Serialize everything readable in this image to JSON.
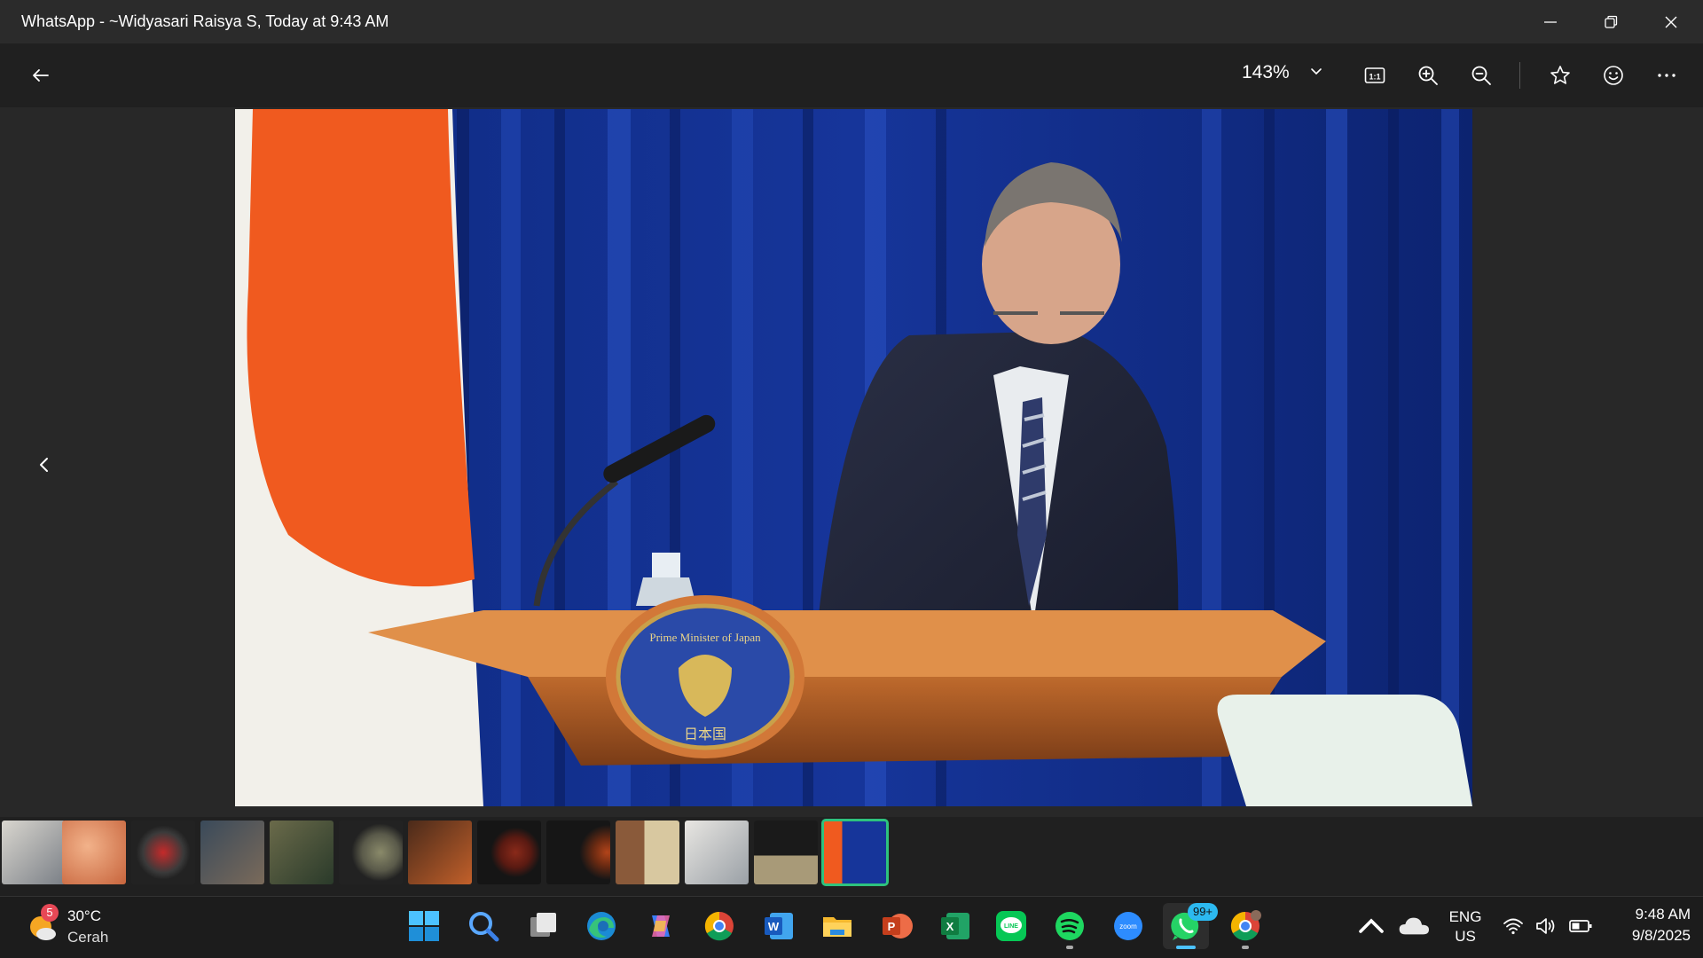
{
  "window": {
    "title": "WhatsApp - ~Widyasari Raisya S, Today at 9:43 AM"
  },
  "toolbar": {
    "zoom_value": "143%",
    "icons": [
      "back-arrow-icon",
      "chevron-down-icon",
      "actual-size-icon",
      "zoom-in-icon",
      "zoom-out-icon",
      "star-icon",
      "emoji-icon",
      "more-icon"
    ]
  },
  "photo": {
    "podium_text_top": "Prime Minister of Japan",
    "podium_text_bottom": "日本国"
  },
  "filmstrip": {
    "thumbnail_count": 13,
    "active_index": 12
  },
  "taskbar": {
    "weather": {
      "temperature": "30°C",
      "condition": "Cerah",
      "badge": "5"
    },
    "apps": [
      "start",
      "search",
      "task-view",
      "edge",
      "copilot",
      "chrome",
      "word",
      "file-explorer",
      "powerpoint",
      "excel",
      "line",
      "spotify",
      "zoom",
      "whatsapp",
      "chrome-profile"
    ],
    "whatsapp_badge": "99+",
    "zoom_label": "zoom",
    "language": {
      "line1": "ENG",
      "line2": "US"
    },
    "clock": {
      "time": "9:48 AM",
      "date": "9/8/2025"
    }
  },
  "colors": {
    "accent_green": "#2ec27e",
    "taskbar_active": "#4cc2ff",
    "titlebar_bg": "#2b2b2b"
  }
}
